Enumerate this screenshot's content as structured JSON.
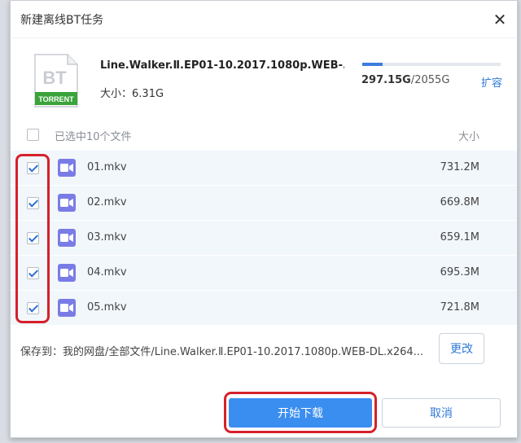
{
  "dialog": {
    "title": "新建离线BT任务",
    "close_symbol": "✕"
  },
  "torrent": {
    "icon_text_top": "BT",
    "icon_text_bottom": "TORRENT",
    "filename": "Line.Walker.Ⅱ.EP01-10.2017.1080p.WEB-...",
    "size_label": "大小：",
    "size_value": "6.31G"
  },
  "quota": {
    "used": "297.15G",
    "separator": "/",
    "total": "2055G",
    "used_fraction": 0.145,
    "expand_label": "扩容"
  },
  "list": {
    "select_all_label": "已选中10个文件",
    "size_header": "大小",
    "files": [
      {
        "name": "01.mkv",
        "size": "731.2M",
        "checked": true
      },
      {
        "name": "02.mkv",
        "size": "669.8M",
        "checked": true
      },
      {
        "name": "03.mkv",
        "size": "659.1M",
        "checked": true
      },
      {
        "name": "04.mkv",
        "size": "695.3M",
        "checked": true
      },
      {
        "name": "05.mkv",
        "size": "721.8M",
        "checked": true
      }
    ]
  },
  "save_to": {
    "label": "保存到：",
    "path": "我的网盘/全部文件/Line.Walker.Ⅱ.EP01-10.2017.1080p.WEB-DL.x264...",
    "change_label": "更改"
  },
  "actions": {
    "start_label": "开始下载",
    "cancel_label": "取消"
  },
  "colors": {
    "accent": "#3a8ef0",
    "link": "#2f7ad8",
    "highlight_red": "#d6202a",
    "video_icon": "#7a7ce6",
    "torrent_green": "#3aa33a"
  }
}
